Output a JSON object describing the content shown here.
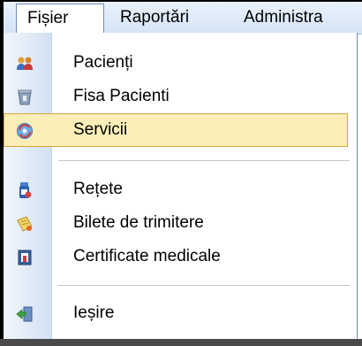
{
  "menubar": {
    "items": [
      {
        "label": "Fișier",
        "active": true
      },
      {
        "label": "Raportări"
      },
      {
        "label": "Administra"
      }
    ]
  },
  "menu": {
    "items": [
      {
        "label": "Pacienți",
        "icon": "patients-icon"
      },
      {
        "label": "Fisa Pacienti",
        "icon": "patient-file-icon"
      },
      {
        "label": "Servicii",
        "icon": "services-icon",
        "highlighted": true
      },
      {
        "label": "Rețete",
        "icon": "prescriptions-icon"
      },
      {
        "label": "Bilete de trimitere",
        "icon": "referral-tickets-icon"
      },
      {
        "label": "Certificate medicale",
        "icon": "medical-certificates-icon"
      },
      {
        "label": "Ieșire",
        "icon": "exit-icon"
      }
    ]
  },
  "colors": {
    "highlight_fill": "#fbeeb8",
    "highlight_border": "#d7a641",
    "menubar": "#d5e4f6",
    "icon_strip": "#d2e1f3"
  }
}
